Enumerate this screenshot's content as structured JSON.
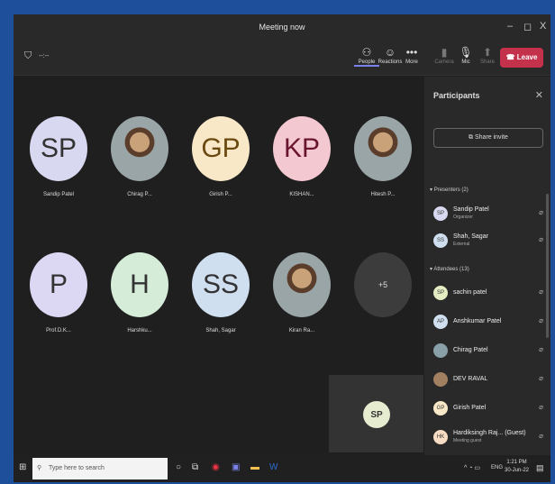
{
  "window": {
    "title": "Meeting now",
    "min": "–",
    "max": "◻",
    "close": "X"
  },
  "toolbar": {
    "timer": "--:--",
    "people": "People",
    "reactions": "Reactions",
    "more": "More",
    "camera": "Camera",
    "mic": "Mic",
    "share": "Share",
    "leave": "Leave"
  },
  "tiles": [
    {
      "initials": "SP",
      "name": "Sandip Patel",
      "color": "#d8d8f0"
    },
    {
      "initials": "",
      "name": "Chirag P...",
      "color": ""
    },
    {
      "initials": "GP",
      "name": "Girish P...",
      "color": "#f8e8c8"
    },
    {
      "initials": "KP",
      "name": "KISHAN...",
      "color": "#f4c8d0"
    },
    {
      "initials": "",
      "name": "Hitesh P...",
      "color": ""
    },
    {
      "initials": "P",
      "name": "Prof.D.K...",
      "color": "#dcd8f4"
    },
    {
      "initials": "H",
      "name": "Harshku...",
      "color": "#d4ecd8"
    },
    {
      "initials": "SS",
      "name": "Shah, Sagar",
      "color": "#cfdff0"
    },
    {
      "initials": "",
      "name": "Kiran Ra...",
      "color": ""
    },
    {
      "initials": "+5",
      "name": "",
      "color": "#3c3c3c"
    }
  ],
  "selfview": {
    "initials": "SP"
  },
  "panel": {
    "title": "Participants",
    "share_invite": "Share invite",
    "presenters_label": "Presenters (2)",
    "attendees_label": "Attendees (13)"
  },
  "presenters": [
    {
      "initials": "SP",
      "name": "Sandip Patel",
      "role": "Organizer",
      "color": "#d8d8f0"
    },
    {
      "initials": "SS",
      "name": "Shah, Sagar",
      "role": "External",
      "color": "#cfdff0"
    }
  ],
  "attendees": [
    {
      "initials": "SP",
      "name": "sachin patel",
      "role": "",
      "color": "#e4ecc4"
    },
    {
      "initials": "AP",
      "name": "Anshkumar Patel",
      "role": "",
      "color": "#cfdff0"
    },
    {
      "initials": "",
      "name": "Chirag Patel",
      "role": "",
      "color": "#8aa0a8"
    },
    {
      "initials": "",
      "name": "DEV RAVAL",
      "role": "",
      "color": "#a08060"
    },
    {
      "initials": "GP",
      "name": "Girish Patel",
      "role": "",
      "color": "#f8e8c8"
    },
    {
      "initials": "HK",
      "name": "Hardiksingh Raj... (Guest)",
      "role": "Meeting guest",
      "color": "#f8dcc4"
    }
  ],
  "taskbar": {
    "search_placeholder": "Type here to search",
    "lang": "ENG",
    "time": "1:21 PM",
    "date": "30-Jun-22"
  }
}
